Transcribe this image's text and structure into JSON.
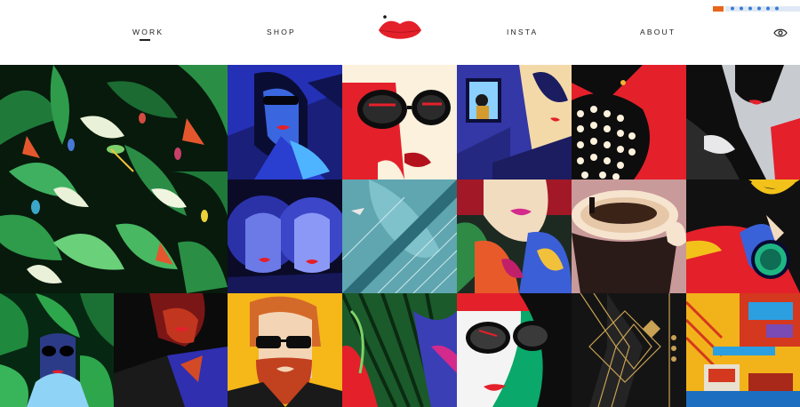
{
  "nav": {
    "items": [
      {
        "label": "WORK",
        "active": true
      },
      {
        "label": "SHOP"
      },
      {
        "label": "INSTA"
      },
      {
        "label": "ABOUT"
      }
    ],
    "logo_icon": "red-lips-logo",
    "right_icon": "eye-icon"
  },
  "colors": {
    "accent_red": "#e4202b",
    "text": "#222222",
    "background": "#ffffff"
  },
  "gallery": {
    "tiles": [
      "jungle-birds",
      "woman-blue-sunglasses",
      "red-sunglasses-closeup",
      "window-blue-night",
      "polka-dot-dress",
      "woman-red-lips-grey",
      "astronaut-twins",
      "zeppelin-teal",
      "woman-floral-leaves",
      "coffee-cup",
      "woman-yellow-pool",
      "face-in-leaves",
      "woman-red-black",
      "bearded-man-sunglasses",
      "palm-leaves",
      "woman-green-sunglasses",
      "art-deco-gold",
      "interior-yellow"
    ]
  }
}
